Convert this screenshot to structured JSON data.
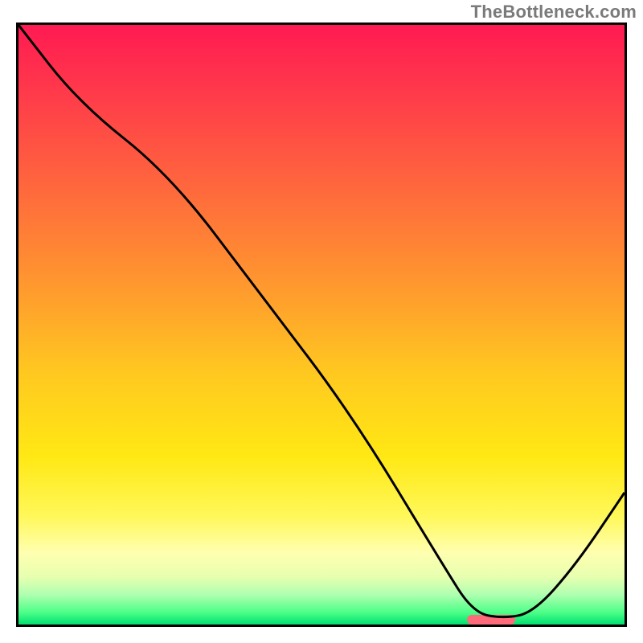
{
  "watermark": "TheBottleneck.com",
  "chart_data": {
    "type": "line",
    "title": "",
    "xlabel": "",
    "ylabel": "",
    "xlim": [
      0,
      100
    ],
    "ylim": [
      0,
      100
    ],
    "grid": false,
    "legend": false,
    "series": [
      {
        "name": "curve",
        "x": [
          0,
          10,
          25,
          40,
          55,
          70,
          75,
          80,
          85,
          92,
          100
        ],
        "values": [
          100,
          87,
          75,
          55,
          35,
          10,
          2,
          1,
          2,
          10,
          22
        ]
      }
    ],
    "optimum_marker": {
      "x_start": 74,
      "x_end": 82,
      "y": 0.8
    },
    "gradient": {
      "stops": [
        {
          "pos": 0,
          "color": "#ff1a52"
        },
        {
          "pos": 12,
          "color": "#ff3c4a"
        },
        {
          "pos": 28,
          "color": "#ff6a3c"
        },
        {
          "pos": 44,
          "color": "#ff9a2e"
        },
        {
          "pos": 58,
          "color": "#ffc820"
        },
        {
          "pos": 72,
          "color": "#ffe814"
        },
        {
          "pos": 82,
          "color": "#fff85a"
        },
        {
          "pos": 88,
          "color": "#ffffb0"
        },
        {
          "pos": 92,
          "color": "#e8ffb0"
        },
        {
          "pos": 95,
          "color": "#b0ffb0"
        },
        {
          "pos": 98,
          "color": "#4cff88"
        },
        {
          "pos": 100,
          "color": "#00e070"
        }
      ]
    }
  }
}
